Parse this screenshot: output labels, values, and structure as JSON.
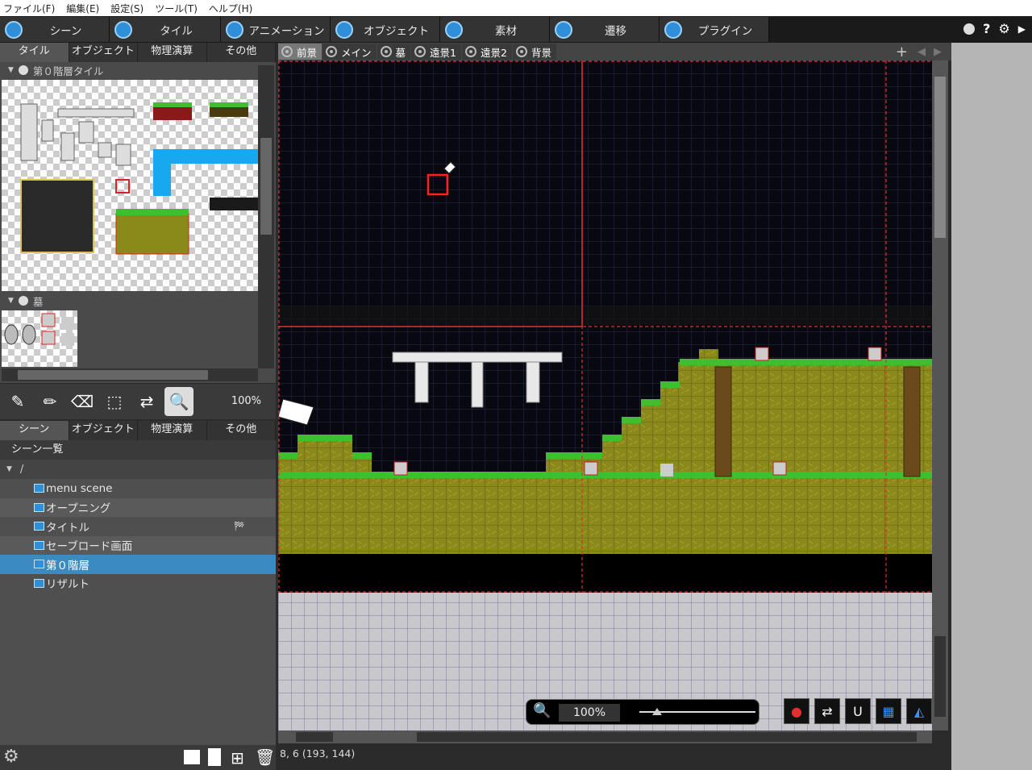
{
  "menu": [
    "ファイル(F)",
    "編集(E)",
    "設定(S)",
    "ツール(T)",
    "ヘルプ(H)"
  ],
  "main_tabs": [
    "シーン",
    "タイル",
    "アニメーション",
    "オブジェクト",
    "素材",
    "遷移",
    "プラグイン"
  ],
  "top_right_icons": [
    "palette-icon",
    "help-icon",
    "gear-icon",
    "play-icon"
  ],
  "tile_panel": {
    "tabs": [
      "タイル",
      "オブジェクト",
      "物理演算",
      "その他"
    ],
    "group1": "第０階層タイル",
    "group2": "墓"
  },
  "tools": {
    "zoom": "100%"
  },
  "scene_panel": {
    "tabs": [
      "シーン",
      "オブジェクト",
      "物理演算",
      "その他"
    ],
    "header": "シーン一覧",
    "root": "/",
    "scenes": [
      "menu scene",
      "オープニング",
      "タイトル",
      "セーブロード画面",
      "第０階層",
      "リザルト"
    ],
    "selected_index": 4
  },
  "layers": [
    "前景",
    "メイン",
    "墓",
    "遠景1",
    "遠景2",
    "背景"
  ],
  "canvas_zoom": "100%",
  "status": "8, 6 (193, 144)",
  "colors": {
    "accent": "#2f8fd8",
    "selected_row": "#3b8bc0",
    "canvas_bg": "#080810",
    "grid": "#2a2a50",
    "grass": "#3fbf2f",
    "dirt": "#8a8a1a"
  }
}
